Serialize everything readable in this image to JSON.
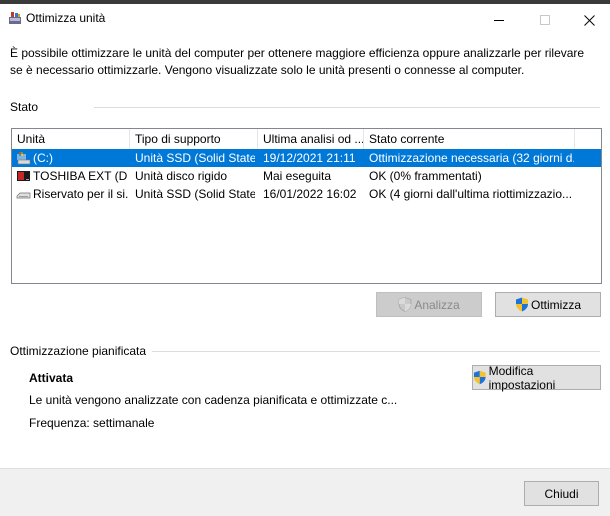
{
  "window": {
    "title": "Ottimizza unità"
  },
  "description": "È possibile ottimizzare le unità del computer per ottenere maggiore efficienza oppure analizzarle per rilevare se è necessario ottimizzarle. Vengono visualizzate solo le unità presenti o connesse al computer.",
  "status_section": {
    "label": "Stato",
    "columns": [
      "Unità",
      "Tipo di supporto",
      "Ultima analisi od ...",
      "Stato corrente"
    ],
    "drives": [
      {
        "icon": "ssd-drive-icon",
        "name": "(C:)",
        "type": "Unità SSD (Solid State...",
        "last": "19/12/2021 21:11",
        "status": "Ottimizzazione necessaria (32 giorni d...",
        "selected": true
      },
      {
        "icon": "external-drive-icon",
        "name": "TOSHIBA EXT (D:)",
        "type": "Unità disco rigido",
        "last": "Mai eseguita",
        "status": "OK (0% frammentati)",
        "selected": false
      },
      {
        "icon": "drive-icon",
        "name": "Riservato per il si...",
        "type": "Unità SSD (Solid State...",
        "last": "16/01/2022 16:02",
        "status": "OK (4 giorni dall'ultima riottimizzazio...",
        "selected": false
      }
    ],
    "analyze_label": "Analizza",
    "optimize_label": "Ottimizza"
  },
  "schedule": {
    "label": "Ottimizzazione pianificata",
    "status": "Attivata",
    "description": "Le unità vengono analizzate con cadenza pianificata e ottimizzate c...",
    "frequency": "Frequenza: settimanale",
    "change_label": "Modifica impostazioni"
  },
  "close_label": "Chiudi"
}
